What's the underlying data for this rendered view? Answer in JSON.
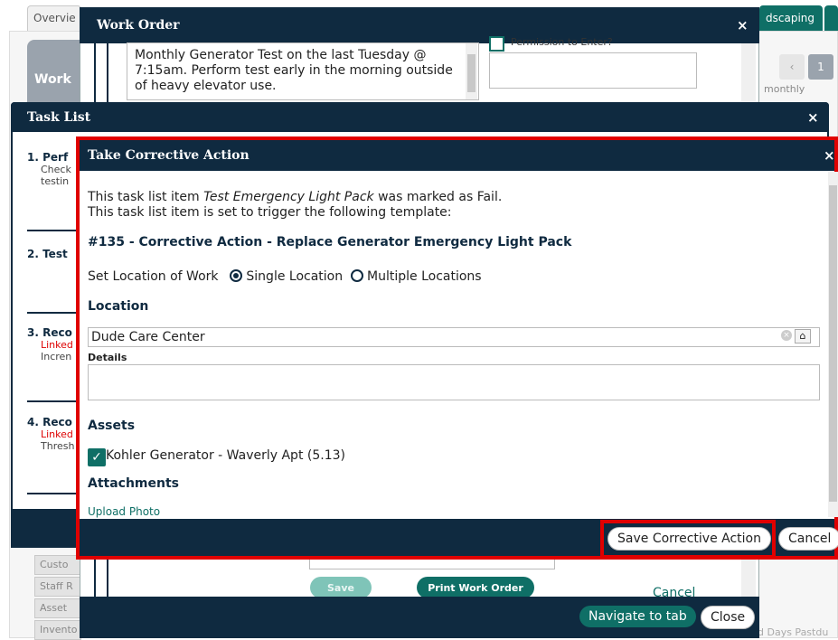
{
  "background": {
    "tabs": [
      "Overvie",
      "dscaping"
    ],
    "card_title": "Work",
    "pager_prev": "‹",
    "pager_current": "1",
    "monthly": "monthly",
    "sidebar_items": [
      "Custo",
      "Staff R",
      "Asset",
      "Invento"
    ],
    "past_due": "d Days Pastdu"
  },
  "work_order": {
    "title": "Work Order",
    "close": "×",
    "description": "Monthly Generator Test on the last Tuesday @ 7:15am. Perform test early in the morning outside of heavy elevator use.",
    "permission_label": "Permission to Enter?",
    "save_label": "Save",
    "print_label": "Print Work Order",
    "cancel_label": "Cancel",
    "navigate_label": "Navigate to tab",
    "close_label": "Close"
  },
  "task_list": {
    "title": "Task List",
    "close": "×",
    "items": [
      {
        "title": "1. Perf",
        "sub1": "Check",
        "sub2": "testin"
      },
      {
        "title": "2. Test"
      },
      {
        "title": "3. Reco",
        "red": "Linked",
        "sub1": "Incren"
      },
      {
        "title": "4. Reco",
        "red": "Linked",
        "sub1": "Thresh"
      }
    ]
  },
  "corrective_action": {
    "title": "Take Corrective Action",
    "close": "×",
    "line1_pre": "This task list item ",
    "line1_item": "Test Emergency Light Pack",
    "line1_post": " was marked as Fail.",
    "line2": "This task list item is set to trigger the following template:",
    "template_name": "#135 - Corrective Action - Replace Generator Emergency Light Pack",
    "set_location_label": "Set Location of Work",
    "option_single": "Single Location",
    "option_multiple": "Multiple Locations",
    "selected_option": "single",
    "location_heading": "Location",
    "location_value": "Dude Care Center",
    "details_label": "Details",
    "details_value": "",
    "assets_heading": "Assets",
    "asset_name": "Kohler Generator - Waverly Apt (5.13)",
    "asset_checked": true,
    "attachments_heading": "Attachments",
    "upload_label": "Upload Photo",
    "save_label": "Save Corrective Action",
    "cancel_label": "Cancel"
  },
  "colors": {
    "header_navy": "#0f2a40",
    "accent_teal": "#0f6f66",
    "highlight_red": "#e00000"
  }
}
